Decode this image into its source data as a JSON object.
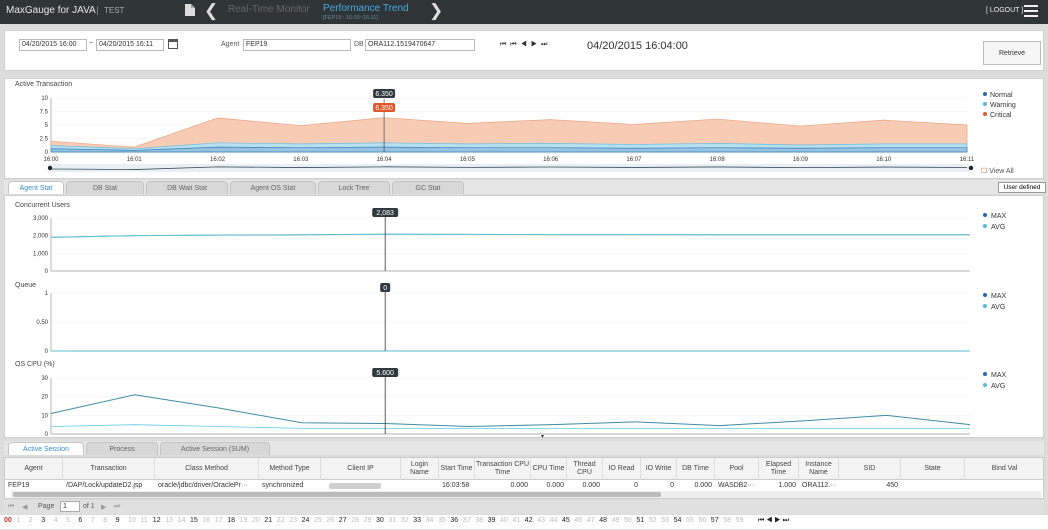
{
  "app": {
    "brand": "MaxGauge for JAVA",
    "sub": "TEST",
    "nav_realtime": "Real-Time Monitor",
    "nav_trend": "Performance Trend",
    "nav_trend_sub": "[FEP19 : 16:00~16:11]",
    "logout": "[ LOGOUT ]"
  },
  "filter": {
    "from": "04/20/2015 16:00",
    "sep": "~",
    "to": "04/20/2015 16:11",
    "agent_label": "Agent",
    "agent": "FEP19",
    "db_label": "DB",
    "db": "ORA112.1519470647",
    "transport": "⏮⏮◀▶⏭",
    "current_time": "04/20/2015 16:04:00",
    "retrieve": "Retrieve"
  },
  "active_tx": {
    "title": "Active Transaction",
    "legend": [
      "Normal",
      "Warning",
      "Critical"
    ],
    "view_all": "View  All",
    "marker1": "6.350",
    "marker2": "6.350"
  },
  "tabs": [
    "Agent Stat",
    "DB Stat",
    "DB Wait Stat",
    "Agent OS Stat",
    "Lock Tree",
    "GC Stat"
  ],
  "user_defined": "User defined",
  "concurrent": {
    "title": "Concurrent Users",
    "legend": [
      "MAX",
      "AVG"
    ],
    "marker": "2,083"
  },
  "queue": {
    "title": "Queue",
    "legend": [
      "MAX",
      "AVG"
    ],
    "marker": "0"
  },
  "oscpu": {
    "title": "OS CPU (%)",
    "legend": [
      "MAX",
      "AVG"
    ],
    "marker": "5.600"
  },
  "bottom_tabs": [
    "Active Session",
    "Process",
    "Active Session (SUM)"
  ],
  "grid": {
    "headers": [
      "Agent",
      "Transaction",
      "Class Method",
      "Method Type",
      "Client IP",
      "Login Name",
      "Start Time",
      "Transaction CPU Time",
      "CPU Time",
      "Thread CPU",
      "IO Read",
      "IO Write",
      "DB Time",
      "Pool",
      "Elapsed Time",
      "Instance Name",
      "SID",
      "State",
      "Bind Val"
    ],
    "row": [
      "FEP19",
      "/DAP/Lock/updateD2.jsp",
      "oracle/jdbc/driver/OraclePr···",
      "synchronized",
      "",
      "",
      "16:03:58",
      "0.000",
      "0.000",
      "0.000",
      "0",
      "0",
      "0.000",
      "WASDB2···",
      "1.000",
      "ORA112.···",
      "450",
      "",
      ""
    ]
  },
  "pager": {
    "page_label": "Page",
    "page": "1",
    "of": "of 1"
  },
  "timeline": {
    "labels": [
      "00",
      "1",
      "2",
      "3",
      "4",
      "5",
      "6",
      "7",
      "8",
      "9",
      "10",
      "11",
      "12",
      "13",
      "14",
      "15",
      "16",
      "17",
      "18",
      "19",
      "20",
      "21",
      "22",
      "23",
      "24",
      "25",
      "26",
      "27",
      "28",
      "29",
      "30",
      "31",
      "32",
      "33",
      "34",
      "35",
      "36",
      "37",
      "38",
      "39",
      "40",
      "41",
      "42",
      "43",
      "44",
      "45",
      "46",
      "47",
      "48",
      "49",
      "50",
      "51",
      "52",
      "53",
      "54",
      "55",
      "56",
      "57",
      "58",
      "59"
    ],
    "transport": "⏮ ◀ ▶ ⏭"
  },
  "chart_data": [
    {
      "type": "area",
      "title": "Active Transaction",
      "x": [
        "16:00",
        "16:01",
        "16:02",
        "16:03",
        "16:04",
        "16:05",
        "16:06",
        "16:07",
        "16:08",
        "16:09",
        "16:10",
        "16:11"
      ],
      "xlabel": "",
      "ylabel": "",
      "ylim": [
        0,
        10
      ],
      "yticks": [
        "10",
        "7.5",
        "5",
        "2.5",
        "0"
      ],
      "series": [
        {
          "name": "Critical",
          "values": [
            2.0,
            0.9,
            6.3,
            4.9,
            6.35,
            5.3,
            6.0,
            5.1,
            6.1,
            4.8,
            5.9,
            5.0
          ]
        },
        {
          "name": "Warning",
          "values": [
            1.2,
            0.6,
            1.7,
            1.5,
            1.7,
            1.5,
            1.6,
            1.4,
            1.6,
            1.3,
            1.5,
            1.5
          ]
        },
        {
          "name": "Normal",
          "values": [
            0.6,
            0.3,
            0.9,
            0.8,
            0.9,
            0.8,
            0.8,
            0.7,
            0.8,
            0.7,
            0.8,
            0.8
          ]
        }
      ],
      "legend": "right",
      "colors": [
        "#f6c8b2",
        "#a9d9ec",
        "#8fb8d8"
      ]
    },
    {
      "type": "line",
      "title": "Concurrent Users",
      "ylim": [
        0,
        3000
      ],
      "yticks": [
        "3,000",
        "2,000",
        "1,000",
        "0"
      ],
      "series": [
        {
          "name": "MAX",
          "values": [
            1900,
            2000,
            2030,
            2050,
            2083,
            2070,
            2060,
            2060,
            2050,
            2050,
            2050,
            2050
          ]
        },
        {
          "name": "AVG",
          "values": [
            1900,
            2000,
            2030,
            2050,
            2083,
            2070,
            2060,
            2060,
            2050,
            2050,
            2050,
            2050
          ]
        }
      ],
      "legend": "right"
    },
    {
      "type": "line",
      "title": "Queue",
      "ylim": [
        0,
        1
      ],
      "yticks": [
        "1",
        "0.50",
        "0"
      ],
      "series": [
        {
          "name": "MAX",
          "values": [
            0,
            0,
            0,
            0,
            0,
            0,
            0,
            0,
            0,
            0,
            0,
            0
          ]
        },
        {
          "name": "AVG",
          "values": [
            0,
            0,
            0,
            0,
            0,
            0,
            0,
            0,
            0,
            0,
            0,
            0
          ]
        }
      ],
      "legend": "right"
    },
    {
      "type": "line",
      "title": "OS CPU (%)",
      "ylim": [
        0,
        30
      ],
      "yticks": [
        "30",
        "20",
        "10",
        "0"
      ],
      "series": [
        {
          "name": "MAX",
          "values": [
            11,
            21,
            14,
            6,
            5.6,
            4,
            5,
            6.5,
            4.5,
            7,
            10,
            5
          ]
        },
        {
          "name": "AVG",
          "values": [
            4,
            5,
            4,
            3,
            3,
            3,
            3,
            3,
            3,
            3,
            3,
            3
          ]
        }
      ],
      "legend": "right"
    }
  ]
}
